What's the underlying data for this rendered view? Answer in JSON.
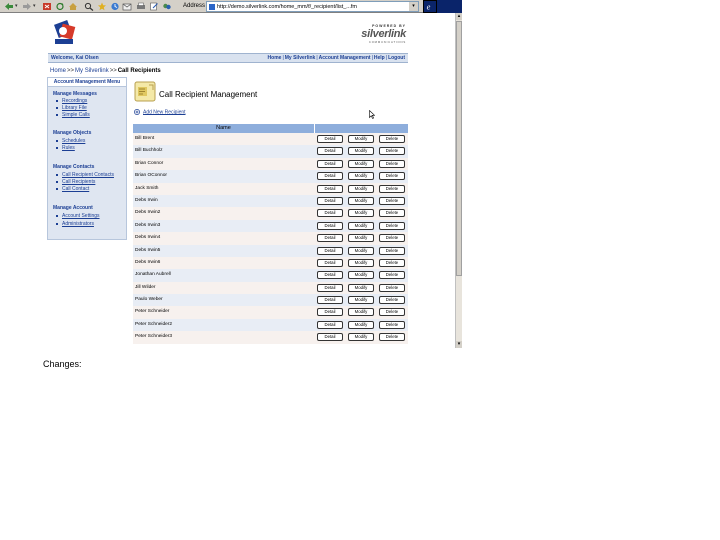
{
  "browser": {
    "address_label": "Address",
    "url": "http://demo.silverlink.com/home_mm/f/_recipient/list_...fm"
  },
  "powered_by": {
    "text": "POWERED BY",
    "brand": "silverlink",
    "sub": "COMMUNICATIONS"
  },
  "topbar": {
    "welcome": "Welcome, Kai Olsen",
    "nav": [
      "Home",
      "My Silverlink",
      "Account Management",
      "Help",
      "Logout"
    ]
  },
  "breadcrumb": {
    "items": [
      "Home",
      "My Silverlink"
    ],
    "current": "Call Recipients"
  },
  "sidebar": {
    "title": "Account Management Menu",
    "sections": [
      {
        "label": "Manage Messages",
        "items": [
          "Recordings",
          "Library File",
          "Simple Calls"
        ]
      },
      {
        "label": "Manage Objects",
        "items": [
          "Schedules",
          "Rules"
        ]
      },
      {
        "label": "Manage Contacts",
        "items": [
          "Call Recipient Contacts",
          "Call Recipients",
          "Call Contact"
        ]
      },
      {
        "label": "Manage Account",
        "items": [
          "Account Settings",
          "Administrators"
        ]
      }
    ]
  },
  "main": {
    "title": "Call Recipient Management",
    "add_new": "Add New Recipient"
  },
  "table": {
    "header_name": "Name",
    "button_labels": {
      "detail": "Detail",
      "modify": "Modify",
      "delete": "Delete"
    },
    "rows": [
      "Bill Brent",
      "Bill Buchholz",
      "Brian Connor",
      "Brian OConnor",
      "Jack Smith",
      "Debs Irwin",
      "Debs Irwin2",
      "Debs Irwin3",
      "Debs Irwin4",
      "Debs Irwin5",
      "Debs Irwin6",
      "Jonathan Aubrell",
      "Jill Wilder",
      "Paulo Weber",
      "Peter Schneider",
      "Peter Schneider2",
      "Peter Schneider3"
    ]
  },
  "notes": {
    "changes_label": "Changes:"
  },
  "colors": {
    "link": "#1c3f94",
    "table_header": "#8eaedc",
    "sidebar_bg": "#dfe6f1",
    "row_alt": "#e8edf5",
    "row_norm": "#f7f1ee"
  }
}
